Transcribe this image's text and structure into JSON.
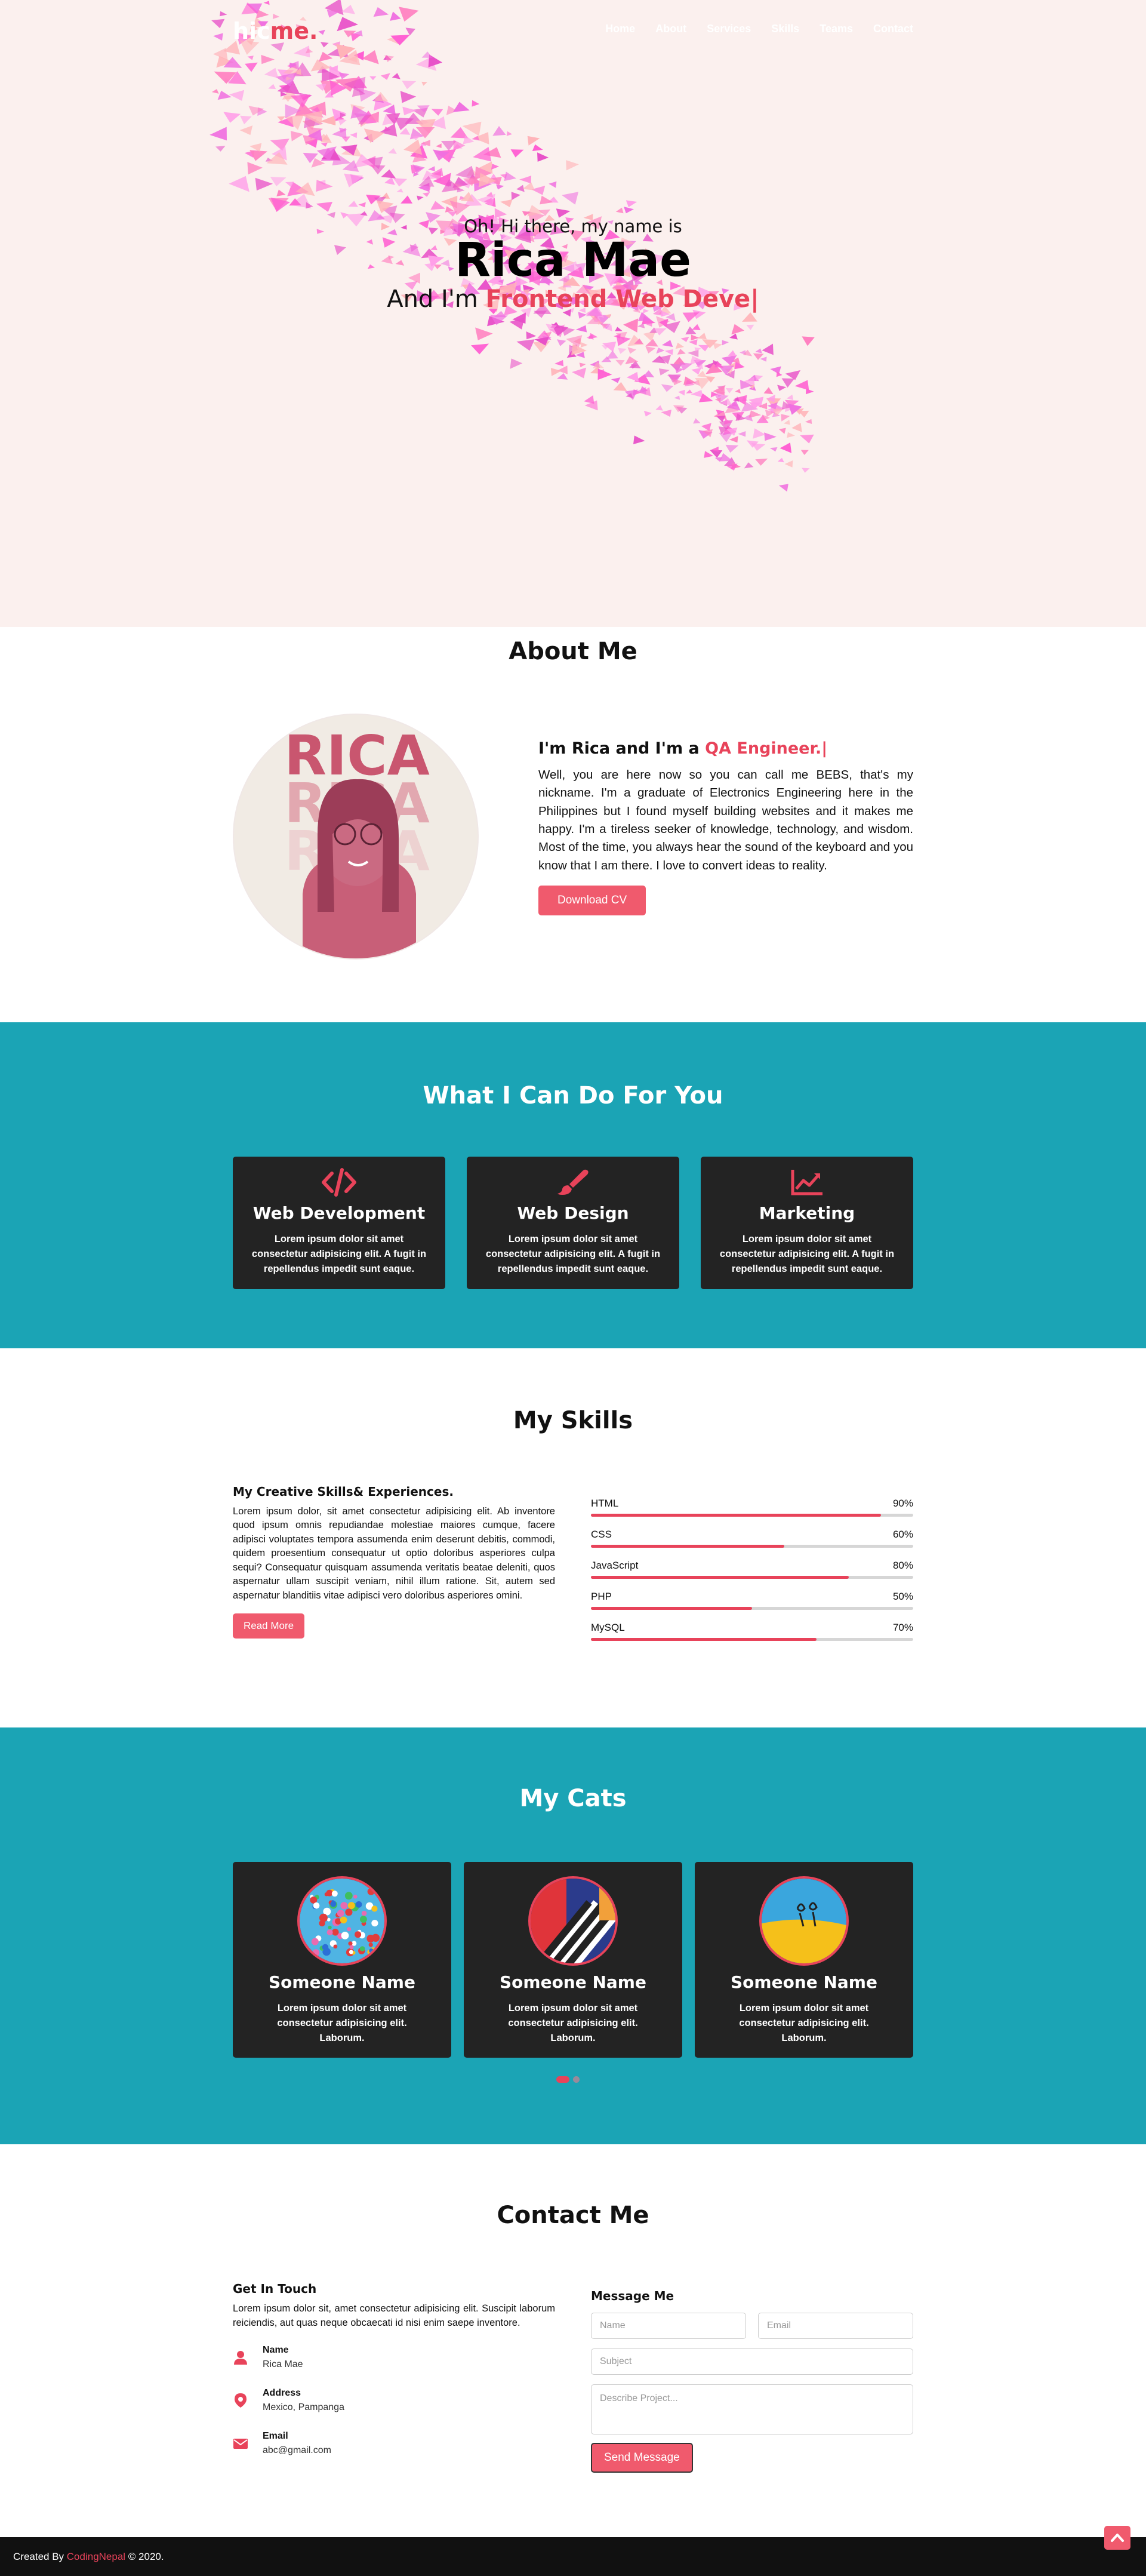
{
  "nav": {
    "logo_main": "hic",
    "logo_accent": "me.",
    "items": [
      "Home",
      "About",
      "Services",
      "Skills",
      "Teams",
      "Contact"
    ]
  },
  "hero": {
    "greeting": "Oh! Hi there, my name is",
    "name": "Rica Mae",
    "role_prefix": "And I'm",
    "role_typed": "Frontend Web Deve|"
  },
  "about": {
    "title": "About Me",
    "avatar_caption": "RICA",
    "heading_prefix": "I'm Rica and I'm a",
    "heading_typed": "QA Engineer.|",
    "paragraph": "Well, you are here now so you can call me BEBS, that's my nickname. I'm a graduate of Electronics Engineering here in the Philippines but I found myself building websites and it makes me happy. I'm a tireless seeker of knowledge, technology, and wisdom. Most of the time, you always hear the sound of the keyboard and you know that I am there. I love to convert ideas to reality.",
    "button": "Download CV"
  },
  "services": {
    "title": "What I Can Do For You",
    "cards": [
      {
        "icon": "code-icon",
        "title": "Web Development",
        "text": "Lorem ipsum dolor sit amet consectetur adipisicing elit. A fugit in repellendus impedit sunt eaque."
      },
      {
        "icon": "paint-brush-icon",
        "title": "Web Design",
        "text": "Lorem ipsum dolor sit amet consectetur adipisicing elit. A fugit in repellendus impedit sunt eaque."
      },
      {
        "icon": "chart-line-icon",
        "title": "Marketing",
        "text": "Lorem ipsum dolor sit amet consectetur adipisicing elit. A fugit in repellendus impedit sunt eaque."
      }
    ]
  },
  "skills": {
    "title": "My Skills",
    "subtitle": "My Creative Skills& Experiences.",
    "paragraph": "Lorem ipsum dolor, sit amet consectetur adipisicing elit. Ab inventore quod ipsum omnis repudiandae molestiae maiores cumque, facere adipisci voluptates tempora assumenda enim deserunt debitis, commodi, quidem proesentium consequatur ut optio doloribus asperiores culpa sequi? Consequatur quisquam assumenda veritatis beatae deleniti, quos aspernatur ullam suscipit veniam, nihil illum ratione. Sit, autem sed aspernatur blanditiis vitae adipisci vero doloribus asperiores omini.",
    "button": "Read More",
    "bars": [
      {
        "name": "HTML",
        "label": "90%",
        "value": 0.9
      },
      {
        "name": "CSS",
        "label": "60%",
        "value": 0.6
      },
      {
        "name": "JavaScript",
        "label": "80%",
        "value": 0.8
      },
      {
        "name": "PHP",
        "label": "50%",
        "value": 0.5
      },
      {
        "name": "MySQL",
        "label": "70%",
        "value": 0.7
      }
    ]
  },
  "cats": {
    "title": "My Cats",
    "cards": [
      {
        "name": "Someone Name",
        "text": "Lorem ipsum dolor sit amet consectetur adipisicing elit. Laborum."
      },
      {
        "name": "Someone Name",
        "text": "Lorem ipsum dolor sit amet consectetur adipisicing elit. Laborum."
      },
      {
        "name": "Someone Name",
        "text": "Lorem ipsum dolor sit amet consectetur adipisicing elit. Laborum."
      }
    ]
  },
  "contact": {
    "title": "Contact Me",
    "left_heading": "Get In Touch",
    "intro": "Lorem ipsum dolor sit, amet consectetur adipisicing elit. Suscipit laborum reiciendis, aut quas neque obcaecati id nisi enim saepe inventore.",
    "items": [
      {
        "icon": "user-icon",
        "label": "Name",
        "value": "Rica Mae"
      },
      {
        "icon": "map-marker-icon",
        "label": "Address",
        "value": "Mexico, Pampanga"
      },
      {
        "icon": "envelope-icon",
        "label": "Email",
        "value": "abc@gmail.com"
      }
    ],
    "right_heading": "Message Me",
    "placeholders": {
      "name": "Name",
      "email": "Email",
      "subject": "Subject",
      "message": "Describe Project..."
    },
    "send": "Send Message"
  },
  "footer": {
    "prefix": "Created By",
    "brand": "CodingNepal",
    "suffix": "© 2020."
  },
  "colors": {
    "accent": "#e8435a",
    "teal": "#1ba4b5",
    "hero_bg": "#fbf0ee",
    "card_bg": "#232323"
  }
}
